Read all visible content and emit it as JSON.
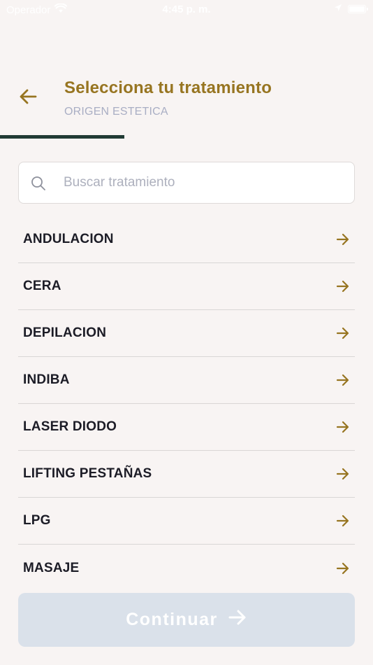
{
  "status_bar": {
    "carrier": "Operador",
    "time": "4:45 p. m.",
    "icons": [
      "wifi-icon",
      "location-icon",
      "battery-icon"
    ]
  },
  "header": {
    "back_icon": "arrow-left-icon",
    "title": "Selecciona tu tratamiento",
    "subtitle": "ORIGEN ESTETICA"
  },
  "progress": {
    "value": 0.333
  },
  "search": {
    "icon": "search-icon",
    "placeholder": "Buscar tratamiento",
    "value": ""
  },
  "treatments": [
    {
      "label": "ANDULACION"
    },
    {
      "label": "CERA"
    },
    {
      "label": "DEPILACION"
    },
    {
      "label": "INDIBA"
    },
    {
      "label": "LASER DIODO"
    },
    {
      "label": "LIFTING PESTAÑAS"
    },
    {
      "label": "LPG"
    },
    {
      "label": "MASAJE"
    }
  ],
  "continue_button": {
    "label": "Continuar",
    "icon": "arrow-right-icon",
    "enabled": false
  },
  "colors": {
    "accent": "#977521",
    "progress": "#213b34",
    "text": "#1c1c26",
    "subtitle": "#a9aec4",
    "button_disabled": "#dae1ea",
    "background": "#f8f4f3"
  }
}
